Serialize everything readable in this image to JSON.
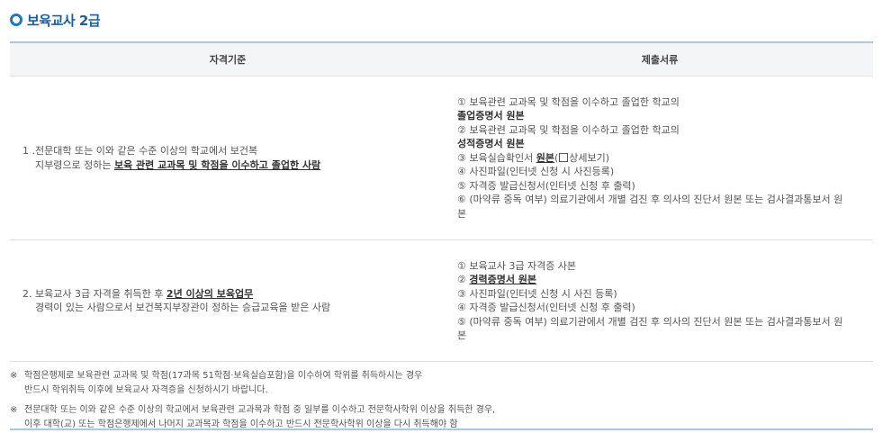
{
  "title": "보육교사 2급",
  "table": {
    "headers": [
      "자격기준",
      "제출서류"
    ],
    "rows": [
      {
        "criteria_line1": "1 .전문대학 또는 이와 같은 수준 이상의 학교에서 보건복",
        "criteria_line2_pre": "지부령으로 정하는 ",
        "criteria_line2_bold": "보육 관련 교과목 및 학점을 이수하고 졸업한 사람",
        "docs": {
          "d1a": "① 보육관련 교과목 및 학점을 이수하고 졸업한 학교의",
          "d1b": "졸업증명서 원본",
          "d2a": "② 보육관련 교과목 및 학점을 이수하고 졸업한 학교의",
          "d2b": "성적증명서 원본",
          "d3_pre": "③ 보육실습확인서 ",
          "d3_bold": "원본",
          "d3_link": "상세보기",
          "d4": "④ 사진파일(인터넷 신청 시 사진등록)",
          "d5": "⑤ 자격증 발급신청서(인터넷 신청 후 출력)",
          "d6a": "⑥ (마약류 중독 여부) 의료기관에서 개별 검진 후 의사의 진단서 원본 또는 검사결과통보서 원",
          "d6b": "본"
        }
      },
      {
        "criteria_line1_pre": "2. 보육교사 3급 자격을 취득한 후 ",
        "criteria_line1_bold": "2년 이상의 보육업무",
        "criteria_line2": "경력이 있는 사람으로서 보건복지부장관이 정하는 승급교육을 받은 사람",
        "docs": {
          "d1": "① 보육교사 3급 자격증 사본",
          "d2_pre": "② ",
          "d2_bold": "경력증명서 원본",
          "d3": "③ 사진파일(인터넷 신청 시 사진 등록)",
          "d4": "④ 자격증 발급신청서(인터넷 신청 후 출력)",
          "d5a": "⑤ (마약류 중독 여부) 의료기관에서 개별 검진 후 의사의 진단서 원본 또는 검사결과통보서 원",
          "d5b": "본"
        }
      }
    ]
  },
  "notes": [
    {
      "mark": "※",
      "line1": "학점은행제로 보육관련 교과목 및 학점(17과목 51학점·보육실습포함)을 이수하여 학위를 취득하시는 경우",
      "line2": "반드시 학위취득 이후에 보육교사 자격증을 신청하시기 바랍니다."
    },
    {
      "mark": "※",
      "line1": "전문대학 또는 이와 같은 수준 이상의 학교에서 보육관련 교과목과 학점 중 일부를 이수하고 전문학사학위 이상을 취득한 경우,",
      "line2": "이후 대학(교) 또는 학점은행제에서 나머지 교과목과 학점을 이수하고 반드시 전문학사학위 이상을 다시 취득해야 함"
    }
  ],
  "colors": {
    "accent": "#1a7bc4",
    "title": "#1a5f9e",
    "border_top": "#a8c8e6",
    "header_bg": "#f4f5f7"
  }
}
